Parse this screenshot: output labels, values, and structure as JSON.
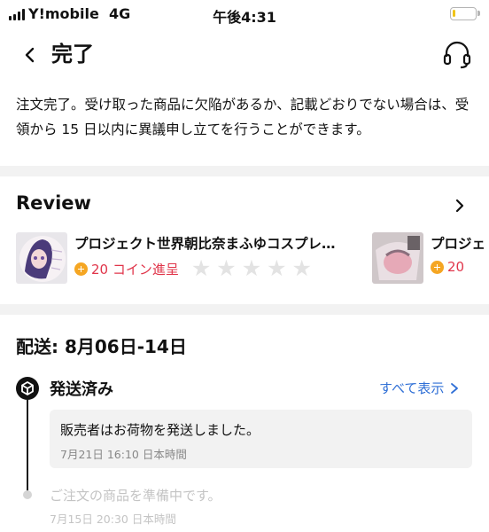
{
  "status_bar": {
    "carrier": "Y!mobile",
    "network": "4G",
    "time": "午後4:31",
    "battery_level": 0.15,
    "battery_color": "#f0c419"
  },
  "header": {
    "back_icon": "chevron-left-icon",
    "title": "完了",
    "support_icon": "headset-icon"
  },
  "notice": "注文完了。受け取った商品に欠陥があるか、記載どおりでない場合は、受領から 15 日以内に異議申し立てを行うことができます。",
  "review": {
    "title": "Review",
    "more_icon": "chevron-right-icon",
    "items": [
      {
        "name": "プロジェクト世界朝比奈まふゆコスプレ…",
        "coin_text": "20 コイン進呈",
        "rating": 0,
        "max_rating": 5
      },
      {
        "name": "プロジェ",
        "coin_text": "20"
      }
    ]
  },
  "delivery": {
    "title": "配送: 8月06日-14日",
    "status_icon": "package-icon",
    "status_label": "発送済み",
    "view_all": "すべて表示",
    "events": [
      {
        "text": "販売者はお荷物を発送しました。",
        "time": "7月21日 16:10 日本時間",
        "active": true
      },
      {
        "text": "ご注文の商品を準備中です。",
        "time": "7月15日 20:30 日本時間",
        "active": false
      }
    ]
  },
  "colors": {
    "accent_link": "#2f6fd6",
    "coin_red": "#e0354a",
    "coin_orange": "#f5a623",
    "star_empty": "#e3e3e3"
  }
}
